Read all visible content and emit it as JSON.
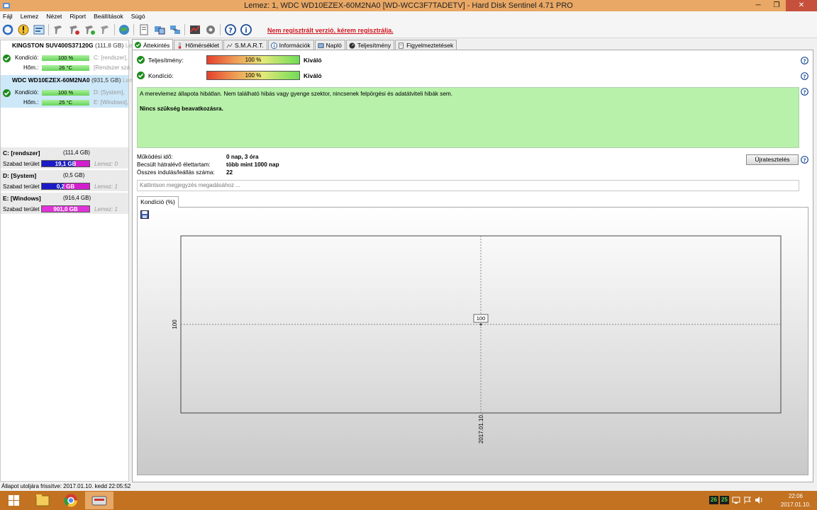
{
  "window": {
    "title": "Lemez: 1, WDC WD10EZEX-60M2NA0 [WD-WCC3F7TADETV]  -  Hard Disk Sentinel 4.71 PRO",
    "min": "─",
    "max": "❐",
    "close": "✕"
  },
  "menu": [
    "Fájl",
    "Lemez",
    "Nézet",
    "Riport",
    "Beállítások",
    "Súgó"
  ],
  "toolbar": {
    "register_link": "Nem regisztrált verzió, kérem regisztrálja.",
    "icons": [
      "refresh-icon",
      "alert-icon",
      "report-icon",
      "repair-tool-icon",
      "repair-tool-2-icon",
      "repair-tool-3-icon",
      "repair-tool-4-icon",
      "globe-icon",
      "document-icon",
      "transfer-icon",
      "network-icon",
      "chart-icon",
      "settings-icon",
      "help-icon",
      "info-icon"
    ]
  },
  "disks": [
    {
      "name": "KINGSTON SUV400S37120G",
      "size": "(111,8 GB)",
      "trail": "Lem",
      "kondicio_label": "Kondíció:",
      "kondicio_value": "100 %",
      "hom_label": "Hőm.:",
      "hom_value": "26 °C",
      "part1": "C: [rendszer],",
      "part2": "[Rendszer szá"
    },
    {
      "name": "WDC WD10EZEX-60M2NA0",
      "size": "(931,5 GB)",
      "trail": "Lem",
      "kondicio_label": "Kondíció:",
      "kondicio_value": "100 %",
      "hom_label": "Hőm.:",
      "hom_value": "25 °C",
      "part1": "D: [System],",
      "part2": "E: [Windows],"
    }
  ],
  "volumes": [
    {
      "name": "C: [rendszer]",
      "size": "(111,4 GB)",
      "free_label": "Szabad terület",
      "free_value": "19,1 GB",
      "disk": "Lemez: 0"
    },
    {
      "name": "D: [System]",
      "size": "(0,5 GB)",
      "free_label": "Szabad terület",
      "free_value": "0,2 GB",
      "disk": "Lemez: 1"
    },
    {
      "name": "E: [Windows]",
      "size": "(916,4 GB)",
      "free_label": "Szabad terület",
      "free_value": "901,0 GB",
      "disk": "Lemez: 1"
    }
  ],
  "tabs": [
    "Áttekintés",
    "Hőmérséklet",
    "S.M.A.R.T.",
    "Információk",
    "Napló",
    "Teljesítmény",
    "Figyelmeztetések"
  ],
  "overview": {
    "performance_label": "Teljesítmény:",
    "performance_value": "100 %",
    "performance_rating": "Kiváló",
    "condition_label": "Kondíció:",
    "condition_value": "100 %",
    "condition_rating": "Kiváló",
    "status_text": "A merevlemez állapota hibátlan. Nem található hibás vagy gyenge szektor, nincsenek felpörgési és adatátviteli hibák sem.",
    "status_action": "Nincs szükség beavatkozásra.",
    "uptime_label": "Működési idő:",
    "uptime_value": "0 nap, 3 óra",
    "lifetime_label": "Becsült hátralévő élettartam:",
    "lifetime_value": "több mint 1000 nap",
    "startstop_label": "Összes indulás/leállás száma:",
    "startstop_value": "22",
    "retest_button": "Újratesztelés",
    "note_placeholder": "Kattintson megjegyzés megadásához ...",
    "chart_tab": "Kondíció  (%)"
  },
  "chart_data": {
    "type": "line",
    "x": [
      "2017.01.10."
    ],
    "series": [
      {
        "values": [
          100
        ]
      }
    ],
    "ytick": "100",
    "xtick": "2017.01.10.",
    "point_label": "100",
    "grid": true
  },
  "statusbar": {
    "text": "Állapot utoljára frissítve: 2017.01.10. kedd 22:05:52"
  },
  "taskbar": {
    "tray_temp1": "26",
    "tray_temp2": "25",
    "time": "22:06",
    "date": "2017.01.10."
  },
  "colors": {
    "titlebar": "#e9a865",
    "taskbar": "#c27221",
    "status_green": "#b8f1aa",
    "register_red": "#d0161e"
  }
}
